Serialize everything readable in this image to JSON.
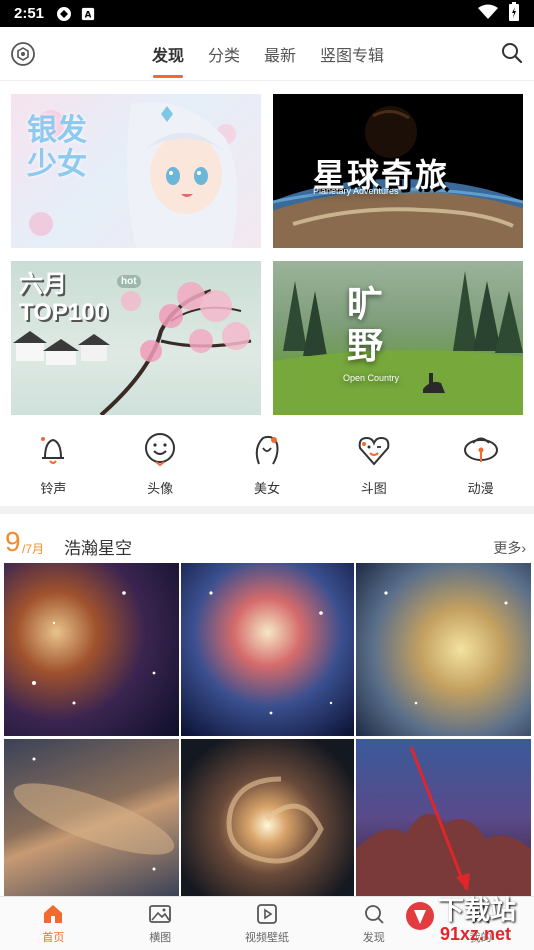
{
  "status_bar": {
    "time": "2:51"
  },
  "top_nav": {
    "tabs": [
      "发现",
      "分类",
      "最新",
      "竖图专辑"
    ],
    "active_tab": "发现"
  },
  "banners": [
    {
      "text": "银发少女"
    },
    {
      "text": "星球奇旅",
      "subtitle": "Planetary Adventures"
    },
    {
      "text": "六月TOP100",
      "badge": "hot"
    },
    {
      "text": "旷野",
      "subtitle": "Open Country"
    }
  ],
  "categories": [
    {
      "label": "铃声",
      "icon": "bell-icon"
    },
    {
      "label": "头像",
      "icon": "smile-icon"
    },
    {
      "label": "美女",
      "icon": "girl-icon"
    },
    {
      "label": "斗图",
      "icon": "heart-face-icon"
    },
    {
      "label": "动漫",
      "icon": "anime-icon"
    }
  ],
  "section": {
    "day": "9",
    "month": "/7月",
    "title": "浩瀚星空",
    "more_label": "更多›"
  },
  "bottom_nav": {
    "items": [
      {
        "label": "首页",
        "icon": "home-icon"
      },
      {
        "label": "横图",
        "icon": "image-icon"
      },
      {
        "label": "视频壁纸",
        "icon": "video-icon"
      },
      {
        "label": "发现",
        "icon": "discover-icon"
      },
      {
        "label": "我的",
        "icon": "user-icon"
      }
    ],
    "active": "首页"
  },
  "watermark": {
    "text_main": "下载站",
    "text_site": "91xz.net"
  },
  "colors": {
    "accent": "#f26a2e",
    "date": "#f28b2a"
  }
}
